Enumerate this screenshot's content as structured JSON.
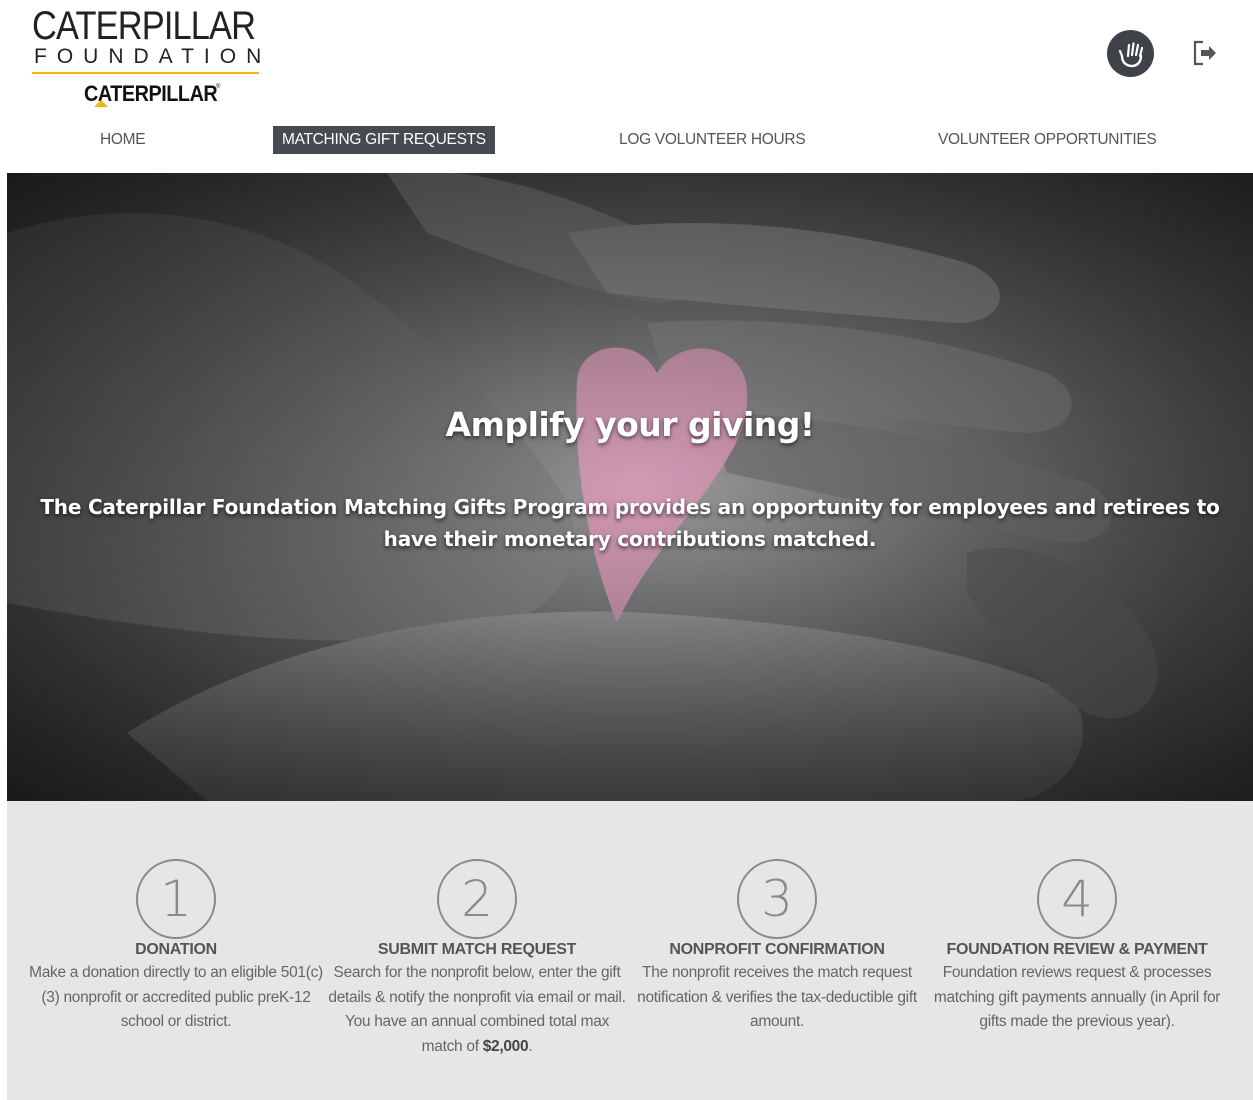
{
  "logo": {
    "line1": "CATERPILLAR",
    "line2": "FOUNDATION",
    "brand": "CATERPILLAR",
    "reg": "®",
    "colors": {
      "accent": "#f2b701"
    }
  },
  "header_icons": {
    "volunteer": "volunteer-hand-icon",
    "logout": "logout-icon"
  },
  "nav": {
    "items": [
      {
        "label": "HOME",
        "active": false
      },
      {
        "label": "MATCHING GIFT REQUESTS",
        "active": true
      },
      {
        "label": "LOG VOLUNTEER HOURS",
        "active": false
      },
      {
        "label": "VOLUNTEER OPPORTUNITIES",
        "active": false
      }
    ]
  },
  "hero": {
    "title": "Amplify your giving!",
    "subtitle": "The Caterpillar Foundation Matching Gifts Program provides an opportunity for employees and retirees to have their monetary contributions matched."
  },
  "steps": [
    {
      "number": "1",
      "title": "DONATION",
      "desc": "Make a donation directly to an eligible 501(c)(3) nonprofit or accredited public preK-12 school or district."
    },
    {
      "number": "2",
      "title": "SUBMIT MATCH REQUEST",
      "desc_pre": "Search for the nonprofit below, enter the gift details & notify the nonprofit via email or mail. You have an annual combined total max match of ",
      "desc_bold": "$2,000",
      "desc_post": "."
    },
    {
      "number": "3",
      "title": "NONPROFIT CONFIRMATION",
      "desc": "The nonprofit receives the match request notification & verifies the tax-deductible gift amount."
    },
    {
      "number": "4",
      "title": "FOUNDATION REVIEW & PAYMENT",
      "desc": "Foundation reviews request & processes matching gift payments annually (in April for gifts made the previous year)."
    }
  ],
  "colors": {
    "nav_active_bg": "#474a51",
    "steps_bg": "#e6e6e6",
    "heart": "#d59bb5"
  }
}
